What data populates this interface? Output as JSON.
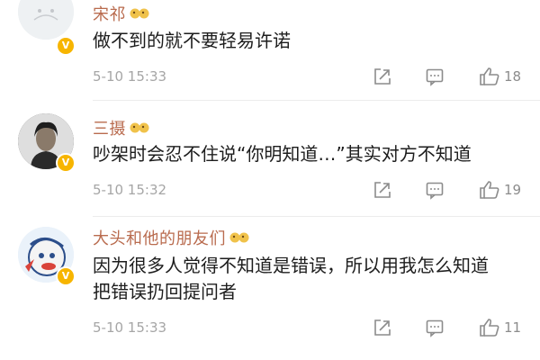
{
  "comments": [
    {
      "username": "宋祁",
      "text": "做不到的就不要轻易许诺",
      "time": "5-10 15:33",
      "likes": "18",
      "badge": "V",
      "avatar_icon": "sketch-avatar"
    },
    {
      "username": "三摄",
      "text": "吵架时会忍不住说“你明知道…”其实对方不知道",
      "time": "5-10 15:32",
      "likes": "19",
      "badge": "V",
      "avatar_icon": "portrait-avatar"
    },
    {
      "username": "大头和他的朋友们",
      "text": "因为很多人觉得不知道是错误，所以用我怎么知道把错误扔回提问者",
      "time": "5-10 15:33",
      "likes": "11",
      "badge": "V",
      "avatar_icon": "cartoon-avatar"
    }
  ],
  "colors": {
    "username": "#b96b4e",
    "badge": "#f7b500",
    "meta": "#a6a6a6",
    "text": "#1d1d1d"
  }
}
